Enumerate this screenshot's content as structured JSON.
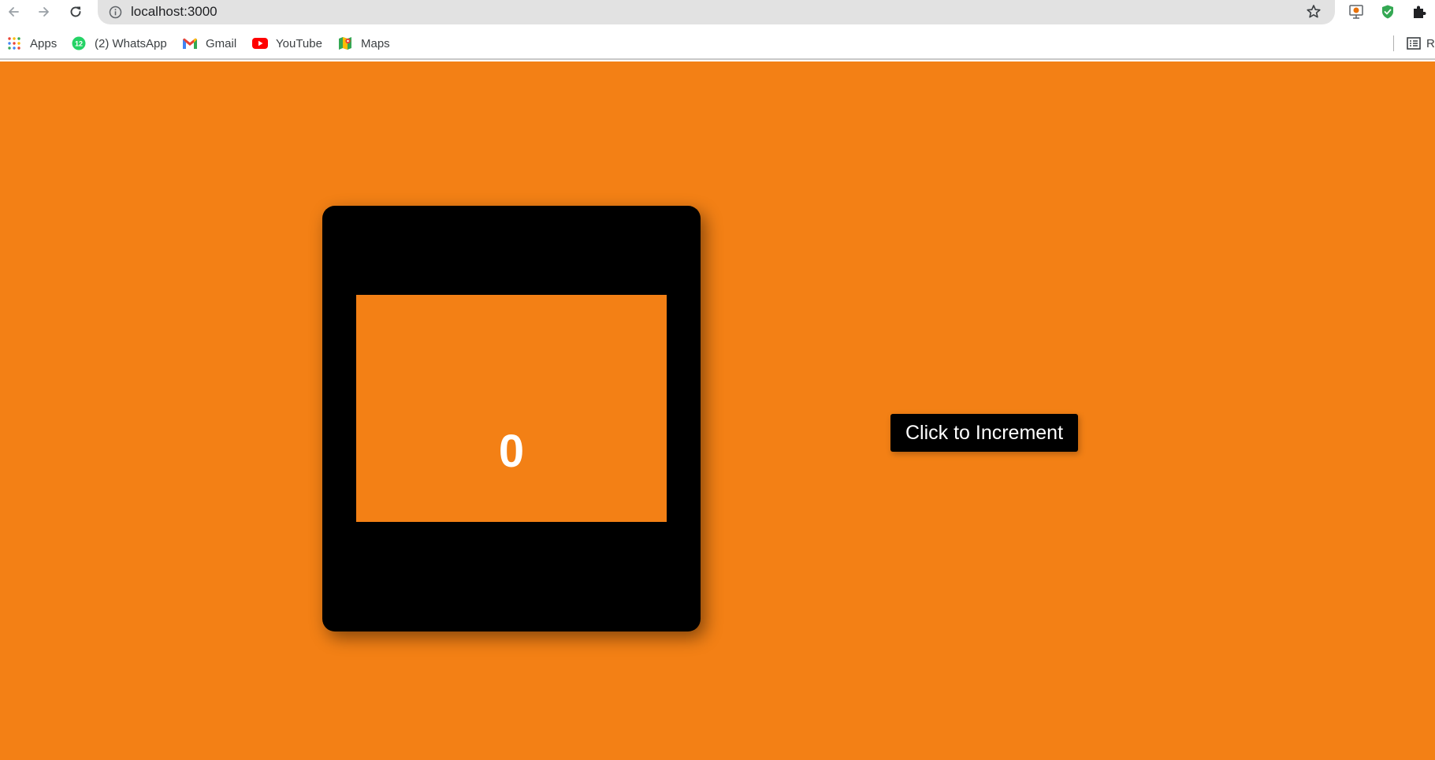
{
  "browser": {
    "url": "localhost:3000",
    "bookmarks": [
      {
        "label": "Apps",
        "icon": "apps-grid-icon"
      },
      {
        "label": "(2) WhatsApp",
        "icon": "whatsapp-icon",
        "badge": "12"
      },
      {
        "label": "Gmail",
        "icon": "gmail-icon"
      },
      {
        "label": "YouTube",
        "icon": "youtube-icon"
      },
      {
        "label": "Maps",
        "icon": "maps-icon"
      }
    ],
    "reading_list_partial": "R"
  },
  "page": {
    "background_color": "#f38015",
    "counter_value": "0",
    "increment_button_label": "Click to Increment"
  }
}
